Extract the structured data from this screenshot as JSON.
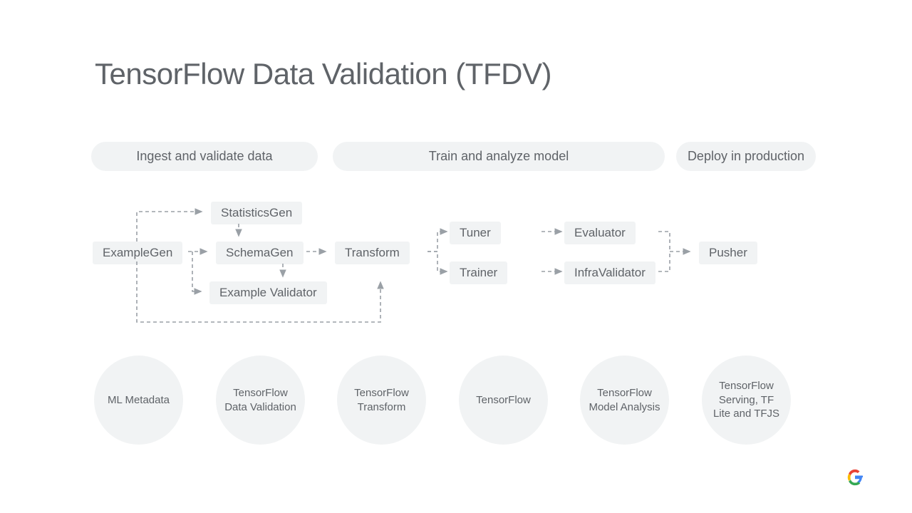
{
  "title": "TensorFlow Data Validation (TFDV)",
  "sections": {
    "ingest": "Ingest and validate data",
    "train": "Train and analyze model",
    "deploy": "Deploy in production"
  },
  "components": {
    "example_gen": "ExampleGen",
    "statistics_gen": "StatisticsGen",
    "schema_gen": "SchemaGen",
    "example_validator": "Example Validator",
    "transform": "Transform",
    "tuner": "Tuner",
    "trainer": "Trainer",
    "evaluator": "Evaluator",
    "infra_validator": "InfraValidator",
    "pusher": "Pusher"
  },
  "libraries": {
    "ml_metadata": "ML Metadata",
    "tfdv": "TensorFlow Data Validation",
    "tf_transform": "TensorFlow Transform",
    "tensorflow": "TensorFlow",
    "tfma": "TensorFlow Model Analysis",
    "tf_serving": "TensorFlow Serving, TF Lite and TFJS"
  }
}
